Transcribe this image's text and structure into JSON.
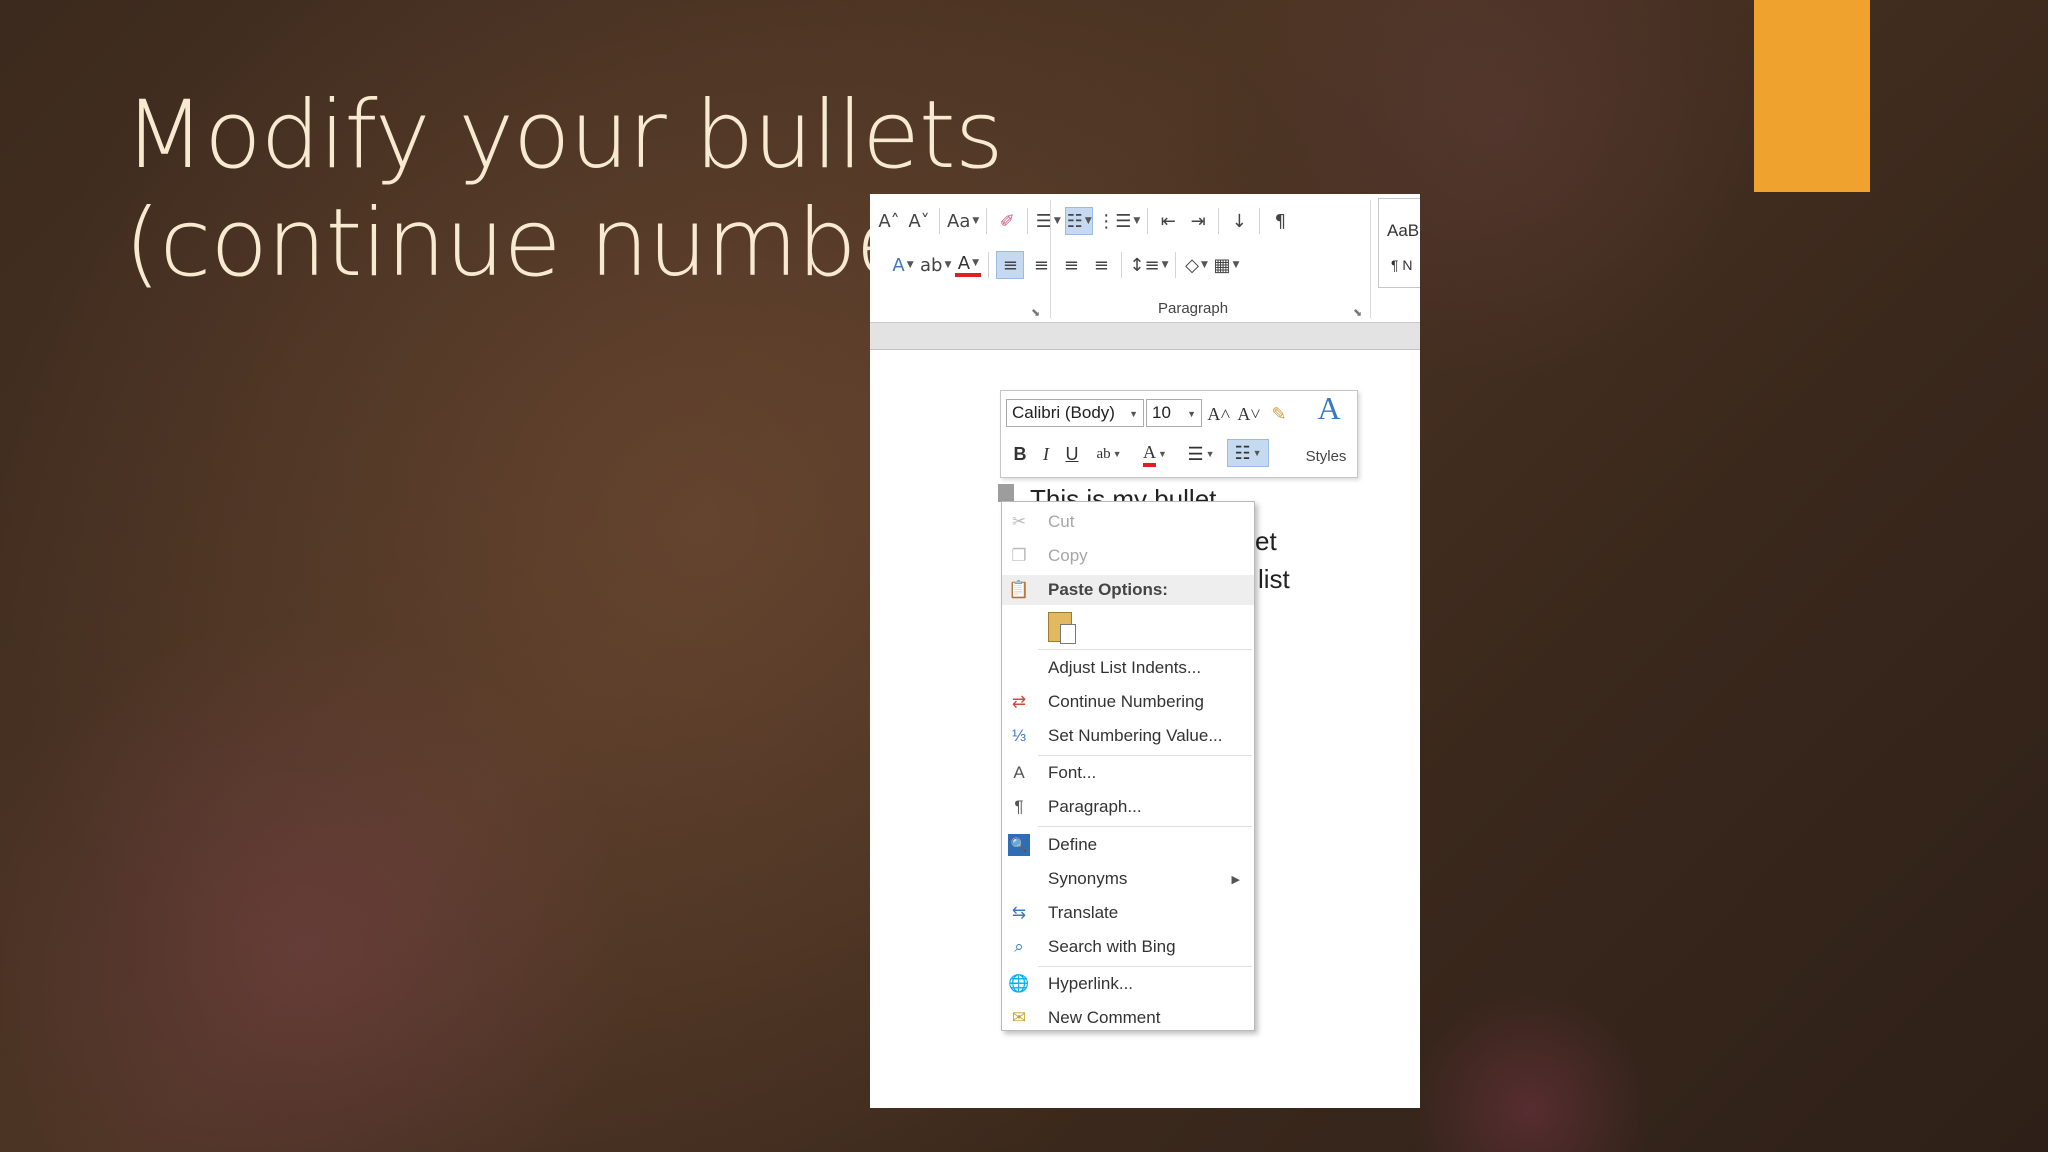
{
  "slide": {
    "title": "Modify your bullets (continue numbering)",
    "accent_color": "#f0a22e"
  },
  "ribbon": {
    "row1": [
      "A˄",
      "A˅",
      "Aa",
      "eraser-icon",
      "bullets-icon",
      "numbering-icon",
      "multilevel-icon",
      "decrease-indent-icon",
      "increase-indent-icon",
      "sort-icon",
      "¶"
    ],
    "row2": [
      "text-effects-icon",
      "highlight-icon",
      "font-color-icon",
      "align-left-icon",
      "center-icon",
      "align-right-icon",
      "justify-icon",
      "line-spacing-icon",
      "shading-icon",
      "borders-icon"
    ],
    "group_label": "Paragraph",
    "styles_preview_1": "AaB",
    "styles_preview_2": "¶ N"
  },
  "document": {
    "line1": "This is my bullet",
    "line2_tail": "et",
    "line3_tail": "list"
  },
  "mini_toolbar": {
    "font_name": "Calibri (Body)",
    "font_size": "10",
    "styles_label": "Styles",
    "bold": "B",
    "italic": "I",
    "underline": "U"
  },
  "context_menu": {
    "items": [
      {
        "label": "Cut",
        "icon": "scissors-icon",
        "disabled": true
      },
      {
        "label": "Copy",
        "icon": "copy-icon",
        "disabled": true
      },
      {
        "label": "Paste Options:",
        "icon": "paste-icon",
        "header": true
      },
      {
        "label": "Adjust List Indents...",
        "icon": ""
      },
      {
        "label": "Continue Numbering",
        "icon": "continue-numbering-icon"
      },
      {
        "label": "Set Numbering Value...",
        "icon": "set-numbering-icon"
      },
      {
        "label": "Font...",
        "icon": "font-icon"
      },
      {
        "label": "Paragraph...",
        "icon": "paragraph-icon"
      },
      {
        "label": "Define",
        "icon": "define-icon"
      },
      {
        "label": "Synonyms",
        "icon": "",
        "submenu": true
      },
      {
        "label": "Translate",
        "icon": "translate-icon"
      },
      {
        "label": "Search with Bing",
        "icon": "search-icon"
      },
      {
        "label": "Hyperlink...",
        "icon": "hyperlink-icon"
      },
      {
        "label": "New Comment",
        "icon": "comment-icon"
      }
    ]
  }
}
